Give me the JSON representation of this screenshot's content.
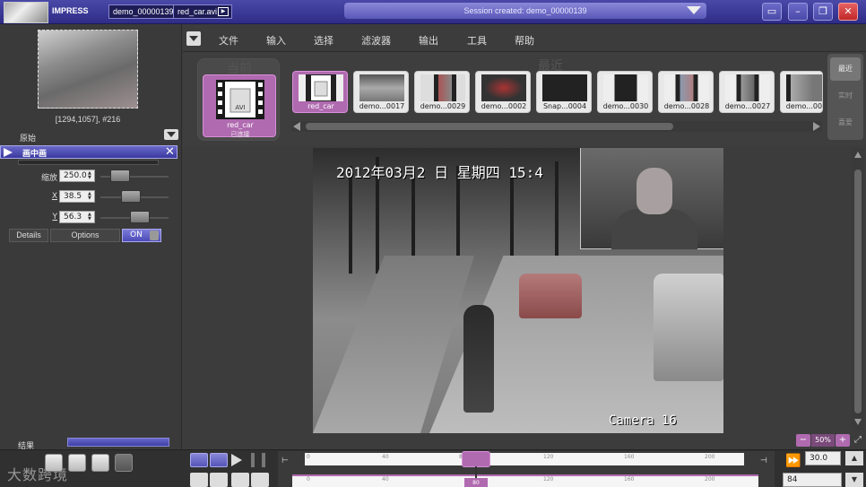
{
  "titlebar": {
    "app_name": "IMPRESS",
    "session_name": "demo_00000139",
    "file_name": "red_car.avi",
    "session_status": "Session created: demo_00000139"
  },
  "left_panel": {
    "coords": "[1294,1057], #216",
    "original_label": "原始",
    "pip": {
      "title": "画中画",
      "params": [
        {
          "label": "缩放",
          "value": "250.0"
        },
        {
          "label": "X",
          "value": "38.5"
        },
        {
          "label": "Y",
          "value": "56.3"
        }
      ],
      "details_label": "Details",
      "options_label": "Options",
      "on_label": "ON"
    },
    "result_label": "结果"
  },
  "menu": {
    "items": [
      "文件",
      "输入",
      "选择",
      "滤波器",
      "输出",
      "工具",
      "帮助"
    ]
  },
  "thumbs": {
    "current_title": "当前",
    "current_name": "red_car",
    "current_status": "已连接",
    "recent_title": "最近",
    "items": [
      {
        "name": "red_car",
        "selected": true
      },
      {
        "name": "demo...0017",
        "selected": false
      },
      {
        "name": "demo...0029",
        "selected": false
      },
      {
        "name": "demo...0002",
        "selected": false
      },
      {
        "name": "Snap...0004",
        "selected": false
      },
      {
        "name": "demo...0030",
        "selected": false
      },
      {
        "name": "demo...0028",
        "selected": false
      },
      {
        "name": "demo...0027",
        "selected": false
      },
      {
        "name": "demo...0026",
        "selected": false
      }
    ],
    "side_tabs": [
      "最近",
      "实时",
      "喜爱"
    ]
  },
  "video": {
    "timestamp": "2012年03月2  日  星期四   15:4",
    "camera": "Camera 16"
  },
  "zoom": {
    "value": "50%"
  },
  "bottom": {
    "watermark": "大数跨境",
    "speed": "30.0",
    "frame": "84",
    "ticks": [
      "0",
      "40",
      "80",
      "120",
      "160",
      "200"
    ],
    "ticks2": [
      "0",
      "40",
      "80",
      "120",
      "160",
      "200"
    ],
    "playhead_label": "80"
  },
  "colors": {
    "accent": "#b06ab0",
    "title_bg": "#3a39a0"
  }
}
